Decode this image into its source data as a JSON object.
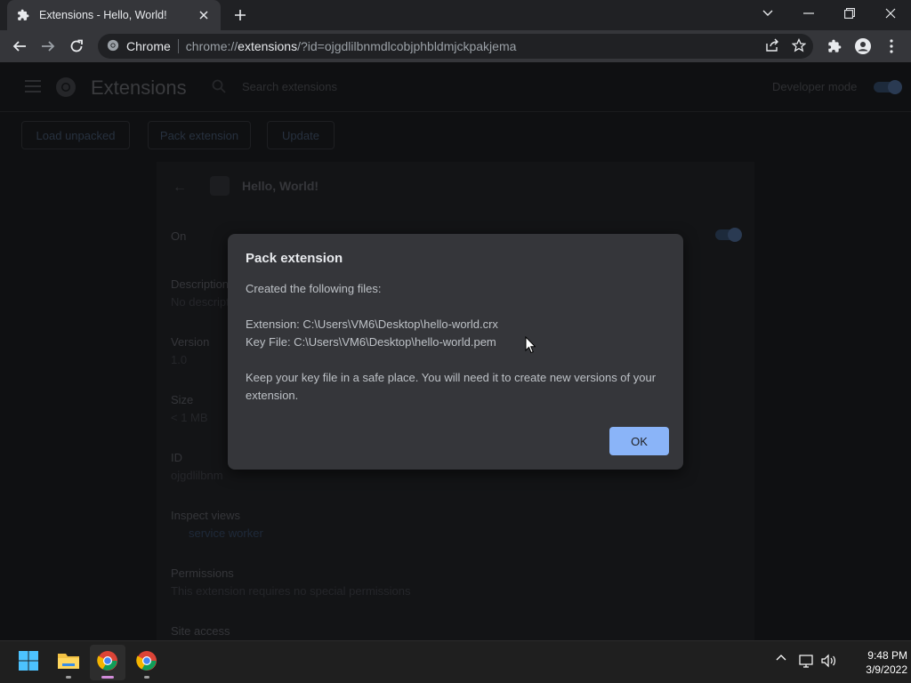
{
  "tab": {
    "title": "Extensions - Hello, World!"
  },
  "omnibox": {
    "site_name": "Chrome",
    "url_prefix": "chrome://",
    "url_host": "extensions",
    "url_rest": "/?id=ojgdlilbnmdlcobjphbldmjckpakjema"
  },
  "page": {
    "title": "Extensions",
    "search_placeholder": "Search extensions",
    "developer_mode_label": "Developer mode",
    "buttons": [
      "Load unpacked",
      "Pack extension",
      "Update"
    ],
    "extension_name": "Hello, World!",
    "on_label": "On",
    "rows": [
      {
        "label": "Description",
        "value": "No description"
      },
      {
        "label": "Version",
        "value": "1.0"
      },
      {
        "label": "Size",
        "value": "< 1 MB"
      },
      {
        "label": "ID",
        "value": "ojgdlilbnm"
      },
      {
        "label": "Inspect views",
        "value": "service worker"
      },
      {
        "label": "Permissions",
        "value": "This extension requires no special permissions"
      },
      {
        "label": "Site access",
        "value": ""
      }
    ]
  },
  "dialog": {
    "title": "Pack extension",
    "intro": "Created the following files:",
    "extension_line": "Extension: C:\\Users\\VM6\\Desktop\\hello-world.crx",
    "keyfile_line": "Key File: C:\\Users\\VM6\\Desktop\\hello-world.pem",
    "note": "Keep your key file in a safe place. You will need it to create new versions of your extension.",
    "ok_label": "OK"
  },
  "taskbar": {
    "time": "9:48 PM",
    "date": "3/9/2022"
  },
  "colors": {
    "accent": "#8ab4f8",
    "dialog_bg": "#35363a",
    "toolbar_bg": "#35363a",
    "tabstrip_bg": "#202124"
  }
}
